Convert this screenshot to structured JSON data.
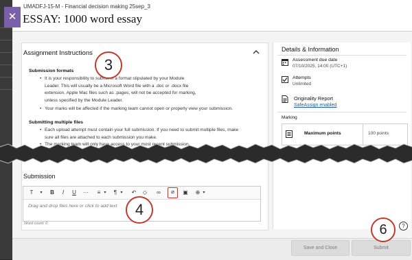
{
  "header": {
    "course_id": "UMADFJ-15-M - Financial decision making 25sep_3",
    "title": "ESSAY: 1000 word essay",
    "close_label": "✕"
  },
  "instructions": {
    "section_title": "Assignment Instructions",
    "submission_formats_heading": "Submission formats",
    "formats_bullets": [
      "It is your responsibility to submit in a format stipulated by your Module Leader. This will usually be a Microsoft Word file with a .doc or .docx file extension. Apple Mac files such as .pages, will not be accepted for marking, unless specified by the Module Leader.",
      "Your marks will be affected if the marking team cannot open or properly view your submission."
    ],
    "multiple_files_heading": "Submitting multiple files",
    "multiple_bullets": [
      "Each upload attempt must contain your full submission. If you need to submit multiple files, make sure all files are attached to each submission you make.",
      "The marking team will only have access to your most recent submission."
    ]
  },
  "details": {
    "section_title": "Details & Information",
    "due_label": "Assessment due date",
    "due_value": "07/10/2025, 14:00 (UTC+1)",
    "attempts_label": "Attempts",
    "attempts_value": "Unlimited",
    "originality_label": "Originality Report",
    "originality_link": "SafeAssign enabled",
    "marking_label": "Marking",
    "max_points_label": "Maximum points",
    "max_points_value": "100 points"
  },
  "submission": {
    "section_title": "Submission",
    "toolbar": {
      "text_style": "T",
      "bold": "B",
      "italic": "I",
      "underline": "U",
      "more": "···",
      "align": "≡",
      "paragraph": "¶",
      "undo": "↶",
      "clear": "◇",
      "link": "∞",
      "attach": "⌀",
      "media": "▣",
      "insert": "⊕"
    },
    "placeholder": "Drag and drop files here or click to add text",
    "word_count": "Word count: 0"
  },
  "callouts": {
    "c3": "3",
    "c4": "4",
    "c6": "6"
  },
  "footer": {
    "save_close": "Save and Close",
    "submit": "Submit",
    "help": "?"
  },
  "colors": {
    "accent_purple": "#7a5fa9",
    "callout_red": "#c0392b",
    "link_blue": "#1c5fa8"
  }
}
